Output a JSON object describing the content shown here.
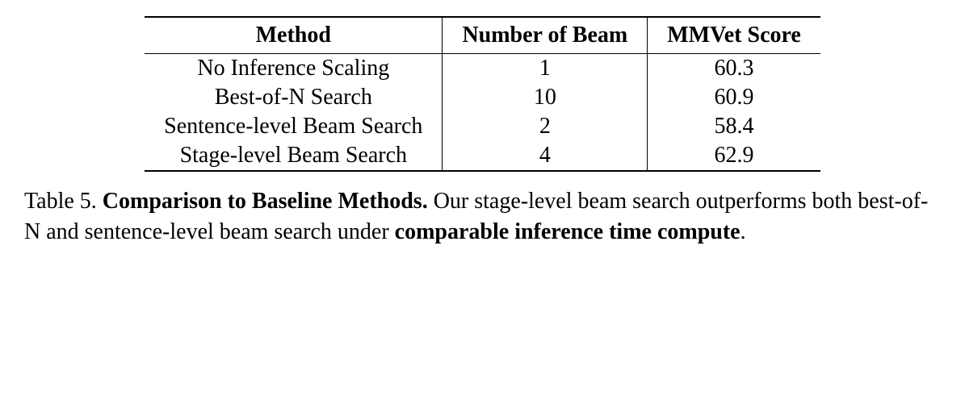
{
  "chart_data": {
    "type": "table",
    "columns": [
      "Method",
      "Number of Beam",
      "MMVet Score"
    ],
    "rows": [
      {
        "method": "No Inference Scaling",
        "beam": 1,
        "score": 60.3
      },
      {
        "method": "Best-of-N Search",
        "beam": 10,
        "score": 60.9
      },
      {
        "method": "Sentence-level Beam Search",
        "beam": 2,
        "score": 58.4
      },
      {
        "method": "Stage-level Beam Search",
        "beam": 4,
        "score": 62.9
      }
    ],
    "caption_label": "Table 5.",
    "caption_title": "Comparison to Baseline Methods.",
    "caption_body_pre": " Our stage-level beam search outperforms both best-of-N and sentence-level beam search under ",
    "caption_bold_phrase": "comparable inference time compute",
    "caption_body_post": "."
  },
  "headers": {
    "c0": "Method",
    "c1": "Number of Beam",
    "c2": "MMVet Score"
  },
  "rows": {
    "r0": {
      "method": "No Inference Scaling",
      "beam": "1",
      "score": "60.3"
    },
    "r1": {
      "method": "Best-of-N Search",
      "beam": "10",
      "score": "60.9"
    },
    "r2": {
      "method": "Sentence-level Beam Search",
      "beam": "2",
      "score": "58.4"
    },
    "r3": {
      "method": "Stage-level Beam Search",
      "beam": "4",
      "score": "62.9"
    }
  },
  "caption": {
    "label": "Table 5.",
    "title": " Comparison to Baseline Methods.",
    "body_pre": " Our stage-level beam search outperforms both best-of-N and sentence-level beam search under ",
    "bold_phrase": "comparable inference time compute",
    "body_post": "."
  }
}
